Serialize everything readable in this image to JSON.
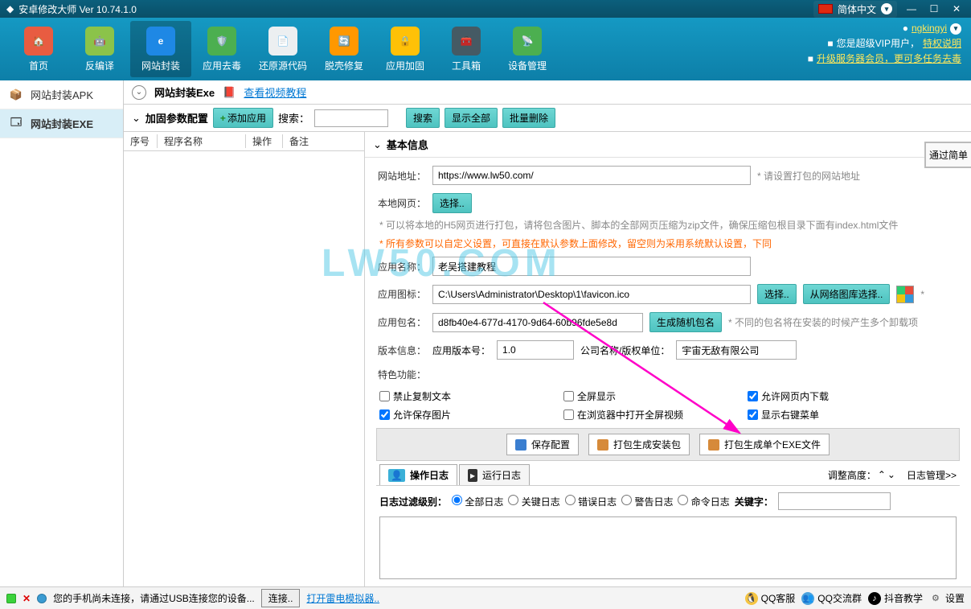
{
  "titlebar": {
    "title": "安卓修改大师 Ver 10.74.1.0",
    "language": "简体中文"
  },
  "user": {
    "name": "ngkingyi",
    "vip_text": "您是超级VIP用户，",
    "vip_link": "特权说明",
    "upgrade_text": "升级服务器会员，更可多任务去毒"
  },
  "toolbar": [
    {
      "label": "首页",
      "icon_color": "#e85c41"
    },
    {
      "label": "反编译",
      "icon_color": "#8bc34a"
    },
    {
      "label": "网站封装",
      "icon_color": "#1e88e5"
    },
    {
      "label": "应用去毒",
      "icon_color": "#4caf50"
    },
    {
      "label": "还原源代码",
      "icon_color": "#607d8b"
    },
    {
      "label": "脱壳修复",
      "icon_color": "#ff9800"
    },
    {
      "label": "应用加固",
      "icon_color": "#ffc107"
    },
    {
      "label": "工具箱",
      "icon_color": "#455a64"
    },
    {
      "label": "设备管理",
      "icon_color": "#4caf50"
    }
  ],
  "sidebar": [
    {
      "label": "网站封装APK"
    },
    {
      "label": "网站封装EXE"
    }
  ],
  "tabhdr": {
    "title": "网站封装Exe",
    "tutorial": "查看视频教程"
  },
  "param": {
    "title": "加固参数配置",
    "add_app": "添加应用",
    "search_label": "搜索：",
    "search_btn": "搜索",
    "show_all": "显示全部",
    "batch_del": "批量删除"
  },
  "list_headers": [
    "序号",
    "程序名称",
    "操作",
    "备注"
  ],
  "basic": {
    "title": "基本信息",
    "url_label": "网站地址：",
    "url_value": "https://www.lw50.com/",
    "url_hint": "* 请设置打包的网站地址",
    "local_label": "本地网页：",
    "select_btn": "选择..",
    "local_hint": "* 可以将本地的H5网页进行打包，请将包含图片、脚本的全部网页压缩为zip文件，确保压缩包根目录下面有index.html文件",
    "param_hint": "* 所有参数可以自定义设置，可直接在默认参数上面修改，留空则为采用系统默认设置，下同",
    "app_name_label": "应用名称：",
    "app_name_value": "老吴搭建教程",
    "icon_label": "应用图标：",
    "icon_value": "C:\\Users\\Administrator\\Desktop\\1\\favicon.ico",
    "icon_net": "从网络图库选择..",
    "pkg_label": "应用包名：",
    "pkg_value": "d8fb40e4-677d-4170-9d64-60b96fde5e8d",
    "pkg_gen": "生成随机包名",
    "pkg_hint": "* 不同的包名将在安装的时候产生多个卸载项",
    "ver_label": "版本信息：",
    "ver_sub": "应用版本号：",
    "ver_value": "1.0",
    "company_label": "公司名称/版权单位：",
    "company_value": "宇宙无敌有限公司",
    "feat_label": "特色功能：",
    "feats": {
      "f1": "禁止复制文本",
      "f2": "允许保存图片",
      "f3": "全屏显示",
      "f4": "在浏览器中打开全屏视频",
      "f5": "允许网页内下载",
      "f6": "显示右键菜单"
    }
  },
  "actions": {
    "save": "保存配置",
    "build_pkg": "打包生成安装包",
    "build_exe": "打包生成单个EXE文件"
  },
  "log": {
    "tab_op": "操作日志",
    "tab_run": "运行日志",
    "height_label": "调整高度：",
    "mgmt": "日志管理>>",
    "filter_label": "日志过滤级别：",
    "levels": [
      "全部日志",
      "关键日志",
      "错误日志",
      "警告日志",
      "命令日志"
    ],
    "keyword_label": "关键字："
  },
  "pass_btn": "通过简单",
  "statusbar": {
    "msg": "您的手机尚未连接，请通过USB连接您的设备...",
    "connect": "连接..",
    "emu": "打开雷电模拟器..",
    "qq_service": "QQ客服",
    "qq_group": "QQ交流群",
    "douyin": "抖音教学",
    "settings": "设置"
  },
  "watermark": "LW50.COM"
}
